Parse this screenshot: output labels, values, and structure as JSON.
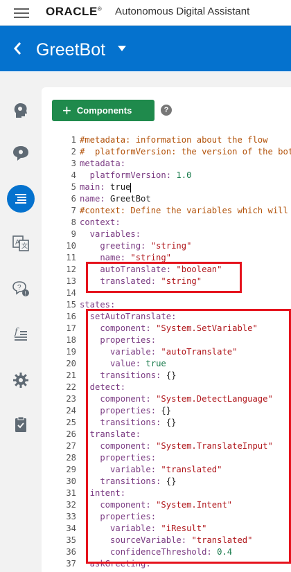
{
  "topbar": {
    "brand": "ORACLE",
    "trademark": "®",
    "product": "Autonomous Digital Assistant"
  },
  "header": {
    "bot_name": "GreetBot"
  },
  "rail_icons": [
    "intents-head-icon",
    "entities-chat-icon",
    "flows-list-icon",
    "translate-icon",
    "qna-icon",
    "functions-icon",
    "settings-gear-icon",
    "clipboard-check-icon"
  ],
  "toolbar": {
    "components_label": "Components",
    "help_glyph": "?"
  },
  "editor": {
    "lines": [
      {
        "n": "1",
        "tokens": [
          {
            "c": "comment",
            "t": "#metadata: information about the flow"
          }
        ]
      },
      {
        "n": "2",
        "tokens": [
          {
            "c": "comment",
            "t": "#  platformVersion: the version of the bot"
          }
        ]
      },
      {
        "n": "3",
        "tokens": [
          {
            "c": "key",
            "t": "metadata:"
          }
        ]
      },
      {
        "n": "4",
        "tokens": [
          {
            "c": "key",
            "t": "  platformVersion: "
          },
          {
            "c": "num",
            "t": "1.0"
          }
        ]
      },
      {
        "n": "5",
        "tokens": [
          {
            "c": "key",
            "t": "main: "
          },
          {
            "c": "plain",
            "t": "true"
          }
        ],
        "cursor": true
      },
      {
        "n": "6",
        "tokens": [
          {
            "c": "key",
            "t": "name: "
          },
          {
            "c": "plain",
            "t": "GreetBot"
          }
        ]
      },
      {
        "n": "7",
        "tokens": [
          {
            "c": "comment",
            "t": "#context: Define the variables which will"
          }
        ]
      },
      {
        "n": "8",
        "tokens": [
          {
            "c": "key",
            "t": "context:"
          }
        ]
      },
      {
        "n": "9",
        "tokens": [
          {
            "c": "key",
            "t": "  variables:"
          }
        ]
      },
      {
        "n": "10",
        "tokens": [
          {
            "c": "key",
            "t": "    greeting: "
          },
          {
            "c": "str",
            "t": "\"string\""
          }
        ]
      },
      {
        "n": "11",
        "tokens": [
          {
            "c": "key",
            "t": "    name: "
          },
          {
            "c": "str",
            "t": "\"string\""
          }
        ]
      },
      {
        "n": "12",
        "tokens": [
          {
            "c": "key",
            "t": "    autoTranslate: "
          },
          {
            "c": "str",
            "t": "\"boolean\""
          }
        ]
      },
      {
        "n": "13",
        "tokens": [
          {
            "c": "key",
            "t": "    translated: "
          },
          {
            "c": "str",
            "t": "\"string\""
          }
        ]
      },
      {
        "n": "14",
        "tokens": []
      },
      {
        "n": "15",
        "tokens": [
          {
            "c": "key",
            "t": "states:"
          }
        ]
      },
      {
        "n": "16",
        "tokens": [
          {
            "c": "key",
            "t": "  setAutoTranslate:"
          }
        ]
      },
      {
        "n": "17",
        "tokens": [
          {
            "c": "key",
            "t": "    component: "
          },
          {
            "c": "str",
            "t": "\"System.SetVariable\""
          }
        ]
      },
      {
        "n": "18",
        "tokens": [
          {
            "c": "key",
            "t": "    properties:"
          }
        ]
      },
      {
        "n": "19",
        "tokens": [
          {
            "c": "key",
            "t": "      variable: "
          },
          {
            "c": "str",
            "t": "\"autoTranslate\""
          }
        ]
      },
      {
        "n": "20",
        "tokens": [
          {
            "c": "key",
            "t": "      value: "
          },
          {
            "c": "num",
            "t": "true"
          }
        ]
      },
      {
        "n": "21",
        "tokens": [
          {
            "c": "key",
            "t": "    transitions: "
          },
          {
            "c": "plain",
            "t": "{}"
          }
        ]
      },
      {
        "n": "22",
        "tokens": [
          {
            "c": "key",
            "t": "  detect:"
          }
        ]
      },
      {
        "n": "23",
        "tokens": [
          {
            "c": "key",
            "t": "    component: "
          },
          {
            "c": "str",
            "t": "\"System.DetectLanguage\""
          }
        ]
      },
      {
        "n": "24",
        "tokens": [
          {
            "c": "key",
            "t": "    properties: "
          },
          {
            "c": "plain",
            "t": "{}"
          }
        ]
      },
      {
        "n": "25",
        "tokens": [
          {
            "c": "key",
            "t": "    transitions: "
          },
          {
            "c": "plain",
            "t": "{}"
          }
        ]
      },
      {
        "n": "26",
        "tokens": [
          {
            "c": "key",
            "t": "  translate:"
          }
        ]
      },
      {
        "n": "27",
        "tokens": [
          {
            "c": "key",
            "t": "    component: "
          },
          {
            "c": "str",
            "t": "\"System.TranslateInput\""
          }
        ]
      },
      {
        "n": "28",
        "tokens": [
          {
            "c": "key",
            "t": "    properties:"
          }
        ]
      },
      {
        "n": "29",
        "tokens": [
          {
            "c": "key",
            "t": "      variable: "
          },
          {
            "c": "str",
            "t": "\"translated\""
          }
        ]
      },
      {
        "n": "30",
        "tokens": [
          {
            "c": "key",
            "t": "    transitions: "
          },
          {
            "c": "plain",
            "t": "{}"
          }
        ]
      },
      {
        "n": "31",
        "tokens": [
          {
            "c": "key",
            "t": "  intent:"
          }
        ]
      },
      {
        "n": "32",
        "tokens": [
          {
            "c": "key",
            "t": "    component: "
          },
          {
            "c": "str",
            "t": "\"System.Intent\""
          }
        ]
      },
      {
        "n": "33",
        "tokens": [
          {
            "c": "key",
            "t": "    properties:"
          }
        ]
      },
      {
        "n": "34",
        "tokens": [
          {
            "c": "key",
            "t": "      variable: "
          },
          {
            "c": "str",
            "t": "\"iResult\""
          }
        ]
      },
      {
        "n": "35",
        "tokens": [
          {
            "c": "key",
            "t": "      sourceVariable: "
          },
          {
            "c": "str",
            "t": "\"translated\""
          }
        ]
      },
      {
        "n": "36",
        "tokens": [
          {
            "c": "key",
            "t": "      confidenceThreshold: "
          },
          {
            "c": "num",
            "t": "0.4"
          }
        ]
      },
      {
        "n": "37",
        "tokens": [
          {
            "c": "key",
            "t": "  askGreeting:"
          }
        ]
      }
    ]
  },
  "colors": {
    "brand_blue": "#0572ce",
    "button_green": "#1f8a4c",
    "highlight_red": "#e5131d"
  }
}
